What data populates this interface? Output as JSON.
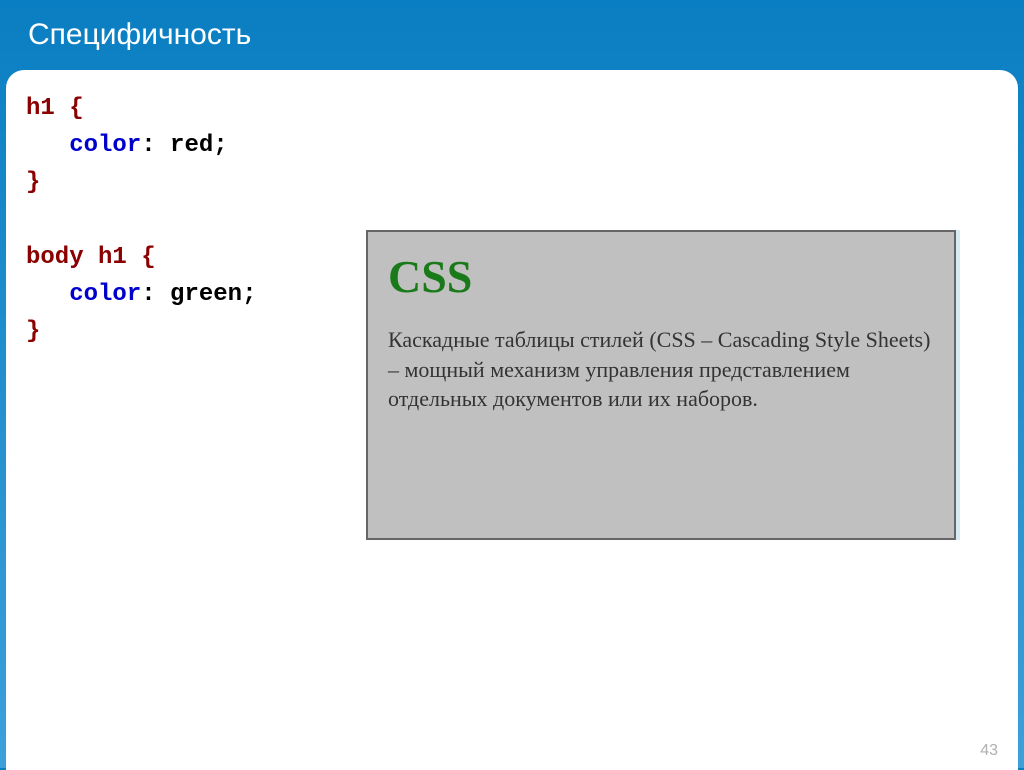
{
  "slide": {
    "title": "Специфичность",
    "page_number": "43"
  },
  "code": {
    "selector1": "h1 {",
    "prop1_indent": "   ",
    "prop1_name": "color",
    "prop1_sep": ": ",
    "prop1_value": "red",
    "prop1_end": ";",
    "close1": "}",
    "blank": " ",
    "selector2": "body h1 {",
    "prop2_indent": "   ",
    "prop2_name": "color",
    "prop2_sep": ": ",
    "prop2_value": "green",
    "prop2_end": ";",
    "close2": "}"
  },
  "preview": {
    "heading": "CSS",
    "paragraph": "Каскадные таблицы стилей (CSS – Cascading Style Sheets) – мощный механизм управления представлением отдельных документов или их наборов."
  }
}
